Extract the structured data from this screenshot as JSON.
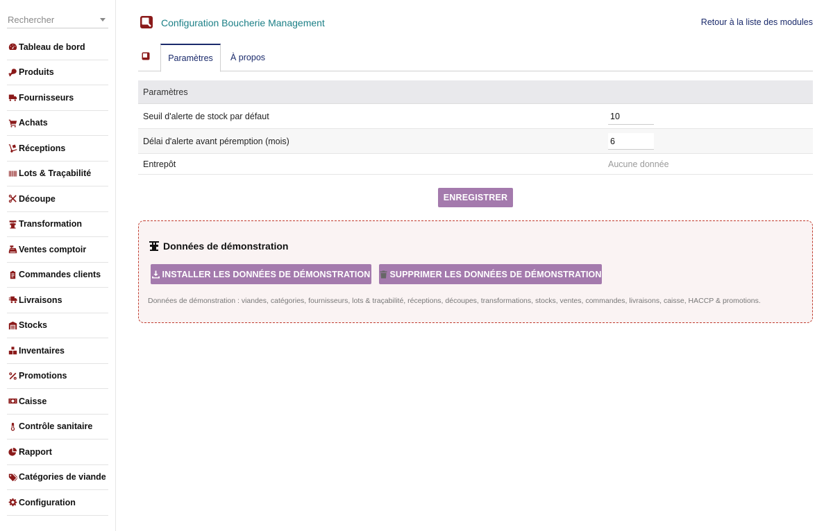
{
  "search": {
    "placeholder": "Rechercher"
  },
  "sidebar": {
    "items": [
      {
        "label": "Tableau de bord",
        "icon": "tachometer-icon"
      },
      {
        "label": "Produits",
        "icon": "drumstick-icon"
      },
      {
        "label": "Fournisseurs",
        "icon": "truck-icon"
      },
      {
        "label": "Achats",
        "icon": "cart-icon"
      },
      {
        "label": "Réceptions",
        "icon": "dolly-icon"
      },
      {
        "label": "Lots & Traçabilité",
        "icon": "barcode-icon"
      },
      {
        "label": "Découpe",
        "icon": "scissors-icon"
      },
      {
        "label": "Transformation",
        "icon": "meat-grinder-icon"
      },
      {
        "label": "Ventes comptoir",
        "icon": "cash-register-icon"
      },
      {
        "label": "Commandes clients",
        "icon": "clipboard-icon"
      },
      {
        "label": "Livraisons",
        "icon": "shipping-icon"
      },
      {
        "label": "Stocks",
        "icon": "warehouse-icon"
      },
      {
        "label": "Inventaires",
        "icon": "boxes-icon"
      },
      {
        "label": "Promotions",
        "icon": "percent-icon"
      },
      {
        "label": "Caisse",
        "icon": "money-icon"
      },
      {
        "label": "Contrôle sanitaire",
        "icon": "thermometer-icon"
      },
      {
        "label": "Rapport",
        "icon": "pie-chart-icon"
      },
      {
        "label": "Catégories de viande",
        "icon": "tags-icon"
      },
      {
        "label": "Configuration",
        "icon": "gear-icon"
      }
    ]
  },
  "header": {
    "title": "Configuration Boucherie Management",
    "back_link": "Retour à la liste des modules"
  },
  "tabs": [
    {
      "label": "Paramètres",
      "active": true
    },
    {
      "label": "À propos",
      "active": false
    }
  ],
  "params": {
    "header": "Paramètres",
    "rows": [
      {
        "label": "Seuil d'alerte de stock par défaut",
        "value": "10"
      },
      {
        "label": "Délai d'alerte avant péremption (mois)",
        "value": "6"
      },
      {
        "label": "Entrepôt",
        "value": "Aucune donnée"
      }
    ]
  },
  "save_label": "ENREGISTRER",
  "demo": {
    "title": "Données de démonstration",
    "install_label": "INSTALLER LES DONNÉES DE DÉMONSTRATION",
    "delete_label": "SUPPRIMER LES DONNÉES DE DÉMONSTRATION",
    "note": "Données de démonstration : viandes, catégories, fournisseurs, lots & traçabilité, réceptions, découpes, transformations, stocks, ventes, commandes, livraisons, caisse, HACCP & promotions."
  },
  "colors": {
    "accent": "#8b1a1a",
    "title": "#1b7f86",
    "button": "#a47aad",
    "link": "#1a2a6b"
  }
}
